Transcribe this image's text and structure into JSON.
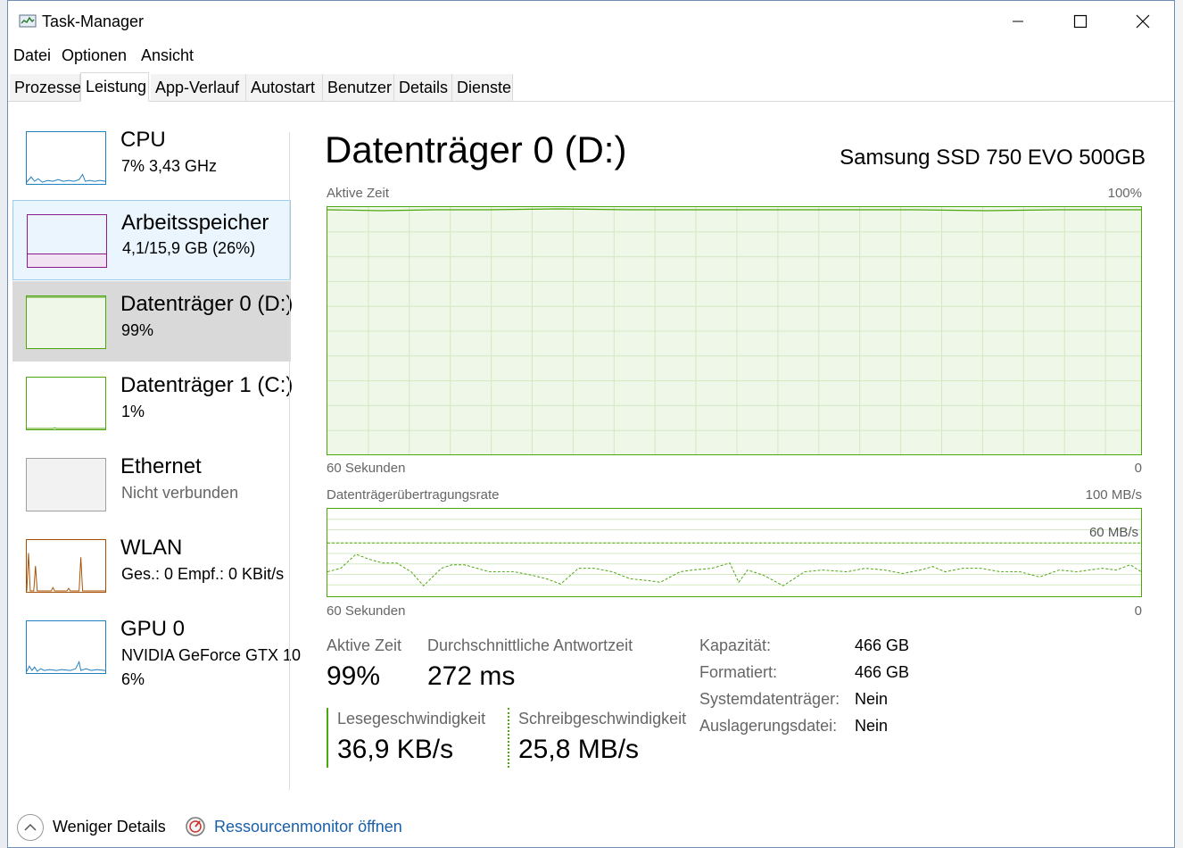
{
  "window": {
    "title": "Task-Manager"
  },
  "menu": [
    "Datei",
    "Optionen",
    "Ansicht"
  ],
  "tabs": [
    "Prozesse",
    "Leistung",
    "App-Verlauf",
    "Autostart",
    "Benutzer",
    "Details",
    "Dienste"
  ],
  "sidebar": [
    {
      "title": "CPU",
      "sub": "7%  3,43 GHz",
      "color": "#1e7fc1"
    },
    {
      "title": "Arbeitsspeicher",
      "sub": "4,1/15,9 GB (26%)",
      "color": "#8b1a8b"
    },
    {
      "title": "Datenträger 0 (D:)",
      "sub": "99%",
      "color": "#4da60c"
    },
    {
      "title": "Datenträger 1 (C:)",
      "sub": "1%",
      "color": "#4da60c"
    },
    {
      "title": "Ethernet",
      "sub": "Nicht verbunden",
      "color": "#a0a0a0"
    },
    {
      "title": "WLAN",
      "sub": "Ges.: 0  Empf.: 0 KBit/s",
      "color": "#a74f01"
    },
    {
      "title": "GPU 0",
      "sub": "NVIDIA GeForce GTX 10",
      "sub2": "6%",
      "color": "#1e7fc1"
    }
  ],
  "main": {
    "title": "Datenträger 0 (D:)",
    "device": "Samsung SSD 750 EVO 500GB",
    "graph1": {
      "label": "Aktive Zeit",
      "max": "100%",
      "time": "60 Sekunden",
      "zero": "0"
    },
    "graph2": {
      "label": "Datenträgerübertragungsrate",
      "max": "100 MB/s",
      "mid": "60 MB/s",
      "time": "60 Sekunden",
      "zero": "0"
    },
    "stats": {
      "active_label": "Aktive Zeit",
      "active_value": "99%",
      "resp_label": "Durchschnittliche Antwortzeit",
      "resp_value": "272 ms",
      "read_label": "Lesegeschwindigkeit",
      "read_value": "36,9 KB/s",
      "write_label": "Schreibgeschwindigkeit",
      "write_value": "25,8 MB/s"
    },
    "props": [
      {
        "label": "Kapazität:",
        "value": "466 GB"
      },
      {
        "label": "Formatiert:",
        "value": "466 GB"
      },
      {
        "label": "Systemdatenträger:",
        "value": "Nein"
      },
      {
        "label": "Auslagerungsdatei:",
        "value": "Nein"
      }
    ]
  },
  "footer": {
    "fewer": "Weniger Details",
    "resmon": "Ressourcenmonitor öffnen"
  },
  "icons": [
    "task-manager-icon",
    "minimize-icon",
    "maximize-icon",
    "close-icon",
    "chevron-up-icon",
    "resource-monitor-icon"
  ]
}
